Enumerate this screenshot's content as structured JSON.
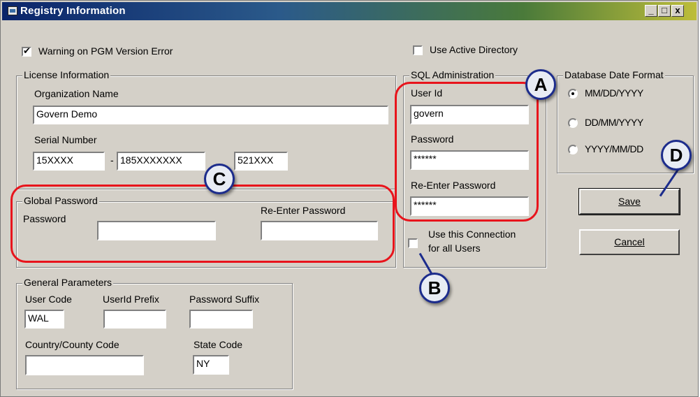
{
  "window": {
    "title": "Registry Information",
    "controls": {
      "minimize": "_",
      "maximize": "□",
      "close": "x"
    }
  },
  "options": {
    "warning_pgm": {
      "label": "Warning on PGM Version Error",
      "checked": true
    },
    "active_directory": {
      "label": "Use Active Directory",
      "checked": false
    }
  },
  "license": {
    "group_label": "License Information",
    "org_label": "Organization Name",
    "org_value": "Govern Demo",
    "serial_label": "Serial Number",
    "serial_part1": "15XXXX",
    "serial_sep": "-",
    "serial_part2": "185XXXXXXX",
    "serial_part3": "521XXX"
  },
  "global_password": {
    "group_label": "Global Password",
    "password_label": "Password",
    "password_value": "",
    "reenter_label": "Re-Enter Password",
    "reenter_value": ""
  },
  "general": {
    "group_label": "General Parameters",
    "user_code_label": "User Code",
    "user_code_value": "WAL",
    "userid_prefix_label": "UserId Prefix",
    "userid_prefix_value": "",
    "password_suffix_label": "Password Suffix",
    "password_suffix_value": "",
    "country_label": "Country/County Code",
    "country_value": "",
    "state_label": "State Code",
    "state_value": "NY"
  },
  "sql": {
    "group_label": "SQL Administration",
    "userid_label": "User Id",
    "userid_value": "govern",
    "password_label": "Password",
    "password_value": "******",
    "reenter_label": "Re-Enter Password",
    "reenter_value": "******",
    "connection_label_line1": "Use this Connection",
    "connection_label_line2": "for all Users",
    "connection_checked": false
  },
  "date_format": {
    "group_label": "Database Date Format",
    "options": [
      {
        "label": "MM/DD/YYYY",
        "selected": true
      },
      {
        "label": "DD/MM/YYYY",
        "selected": false
      },
      {
        "label": "YYYY/MM/DD",
        "selected": false
      }
    ]
  },
  "buttons": {
    "save": {
      "label": "Save"
    },
    "cancel": {
      "label": "Cancel"
    }
  },
  "callouts": {
    "a": "A",
    "b": "B",
    "c": "C",
    "d": "D"
  },
  "colors": {
    "highlight": "#e8141c",
    "badge_border": "#1c2c8c",
    "dialog_bg": "#d4d0c8"
  }
}
